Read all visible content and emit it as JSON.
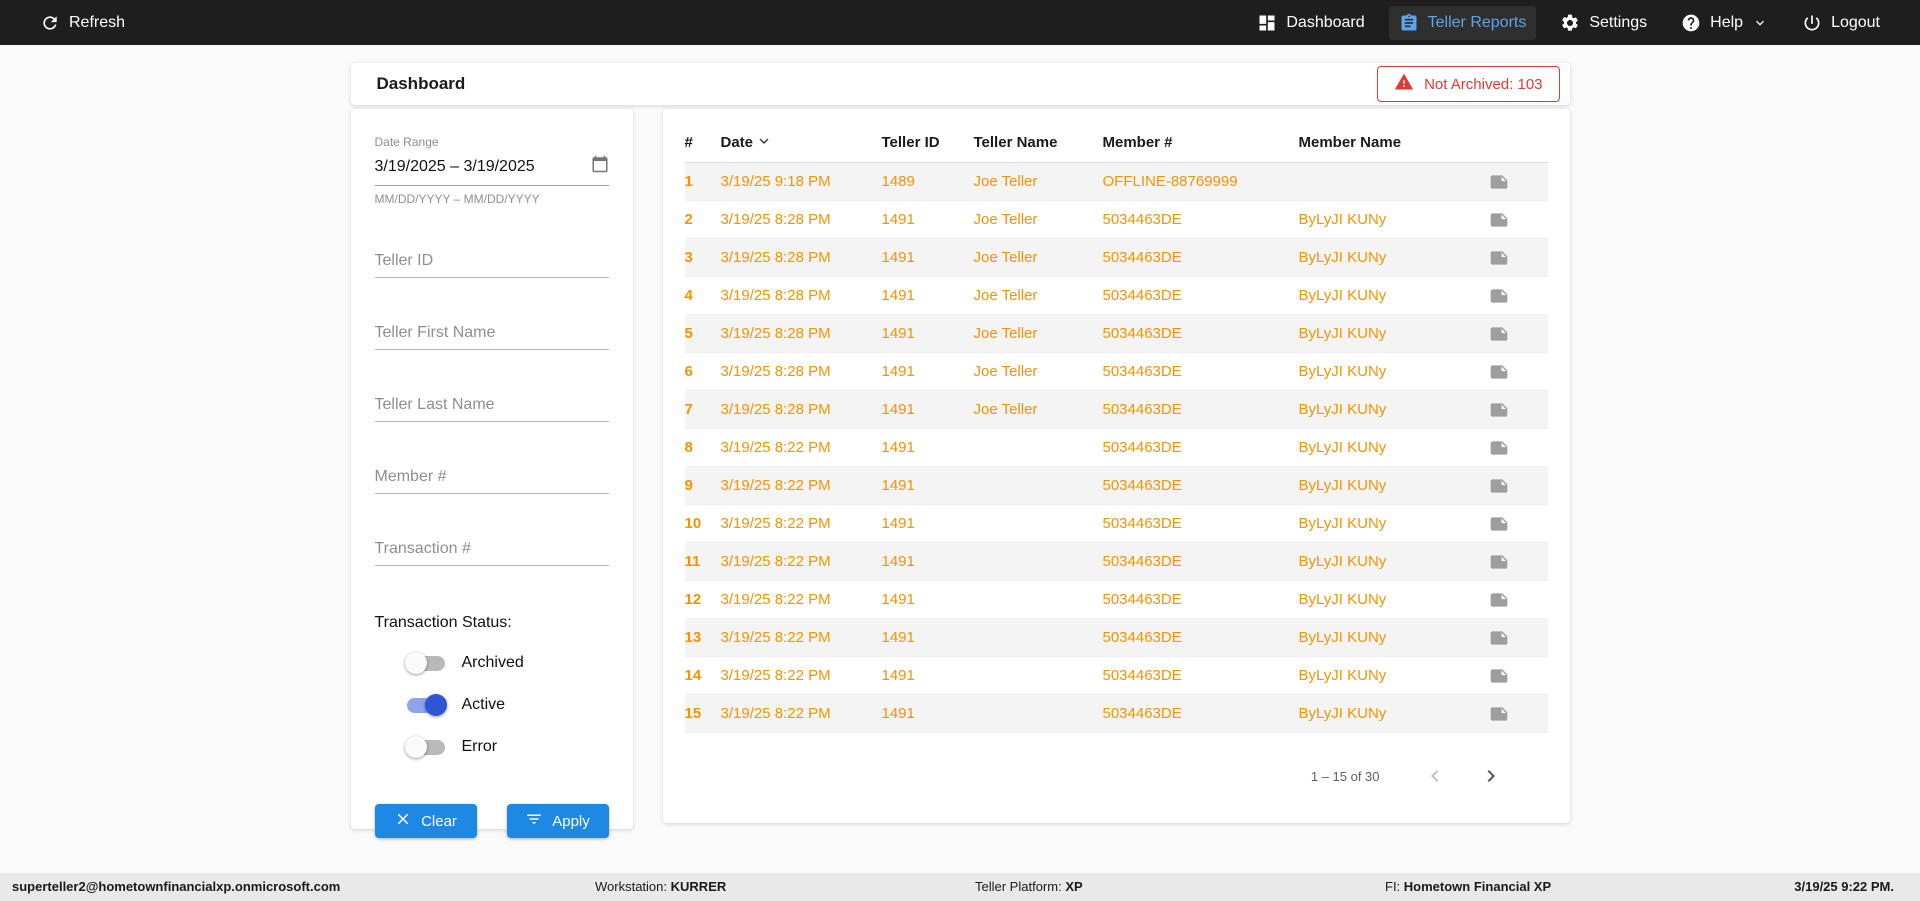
{
  "topbar": {
    "refresh_label": "Refresh",
    "nav": [
      {
        "label": "Dashboard"
      },
      {
        "label": "Teller Reports"
      },
      {
        "label": "Settings"
      },
      {
        "label": "Help"
      },
      {
        "label": "Logout"
      }
    ]
  },
  "header": {
    "title": "Dashboard",
    "not_archived": "Not Archived: 103"
  },
  "filters": {
    "date_range_label": "Date Range",
    "date_range_value": "3/19/2025 – 3/19/2025",
    "date_range_hint": "MM/DD/YYYY – MM/DD/YYYY",
    "fields": [
      {
        "placeholder": "Teller ID"
      },
      {
        "placeholder": "Teller First Name"
      },
      {
        "placeholder": "Teller Last Name"
      },
      {
        "placeholder": "Member #"
      },
      {
        "placeholder": "Transaction #"
      }
    ],
    "status_label": "Transaction Status:",
    "toggles": [
      {
        "label": "Archived",
        "on": false
      },
      {
        "label": "Active",
        "on": true
      },
      {
        "label": "Error",
        "on": false
      }
    ],
    "clear_label": "Clear",
    "apply_label": "Apply"
  },
  "table": {
    "columns": {
      "num": "#",
      "date": "Date",
      "teller_id": "Teller ID",
      "teller_name": "Teller Name",
      "member_num": "Member #",
      "member_name": "Member Name"
    },
    "rows": [
      {
        "num": "1",
        "date": "3/19/25 9:18 PM",
        "teller_id": "1489",
        "teller_name": "Joe Teller",
        "member_num": "OFFLINE-88769999",
        "member_name": ""
      },
      {
        "num": "2",
        "date": "3/19/25 8:28 PM",
        "teller_id": "1491",
        "teller_name": "Joe Teller",
        "member_num": "5034463DE",
        "member_name": "ByLyJI KUNy"
      },
      {
        "num": "3",
        "date": "3/19/25 8:28 PM",
        "teller_id": "1491",
        "teller_name": "Joe Teller",
        "member_num": "5034463DE",
        "member_name": "ByLyJI KUNy"
      },
      {
        "num": "4",
        "date": "3/19/25 8:28 PM",
        "teller_id": "1491",
        "teller_name": "Joe Teller",
        "member_num": "5034463DE",
        "member_name": "ByLyJI KUNy"
      },
      {
        "num": "5",
        "date": "3/19/25 8:28 PM",
        "teller_id": "1491",
        "teller_name": "Joe Teller",
        "member_num": "5034463DE",
        "member_name": "ByLyJI KUNy"
      },
      {
        "num": "6",
        "date": "3/19/25 8:28 PM",
        "teller_id": "1491",
        "teller_name": "Joe Teller",
        "member_num": "5034463DE",
        "member_name": "ByLyJI KUNy"
      },
      {
        "num": "7",
        "date": "3/19/25 8:28 PM",
        "teller_id": "1491",
        "teller_name": "Joe Teller",
        "member_num": "5034463DE",
        "member_name": "ByLyJI KUNy"
      },
      {
        "num": "8",
        "date": "3/19/25 8:22 PM",
        "teller_id": "1491",
        "teller_name": "",
        "member_num": "5034463DE",
        "member_name": "ByLyJI KUNy"
      },
      {
        "num": "9",
        "date": "3/19/25 8:22 PM",
        "teller_id": "1491",
        "teller_name": "",
        "member_num": "5034463DE",
        "member_name": "ByLyJI KUNy"
      },
      {
        "num": "10",
        "date": "3/19/25 8:22 PM",
        "teller_id": "1491",
        "teller_name": "",
        "member_num": "5034463DE",
        "member_name": "ByLyJI KUNy"
      },
      {
        "num": "11",
        "date": "3/19/25 8:22 PM",
        "teller_id": "1491",
        "teller_name": "",
        "member_num": "5034463DE",
        "member_name": "ByLyJI KUNy"
      },
      {
        "num": "12",
        "date": "3/19/25 8:22 PM",
        "teller_id": "1491",
        "teller_name": "",
        "member_num": "5034463DE",
        "member_name": "ByLyJI KUNy"
      },
      {
        "num": "13",
        "date": "3/19/25 8:22 PM",
        "teller_id": "1491",
        "teller_name": "",
        "member_num": "5034463DE",
        "member_name": "ByLyJI KUNy"
      },
      {
        "num": "14",
        "date": "3/19/25 8:22 PM",
        "teller_id": "1491",
        "teller_name": "",
        "member_num": "5034463DE",
        "member_name": "ByLyJI KUNy"
      },
      {
        "num": "15",
        "date": "3/19/25 8:22 PM",
        "teller_id": "1491",
        "teller_name": "",
        "member_num": "5034463DE",
        "member_name": "ByLyJI KUNy"
      }
    ],
    "pagination": {
      "range_label": "1 – 15 of 30"
    }
  },
  "footer": {
    "user": "superteller2@hometownfinancialxp.onmicrosoft.com",
    "workstation_label": "Workstation:",
    "workstation_value": "KURRER",
    "platform_label": "Teller Platform:",
    "platform_value": "XP",
    "fi_label": "FI:",
    "fi_value": "Hometown Financial XP",
    "timestamp": "3/19/25 9:22 PM."
  },
  "colors": {
    "accent_blue": "#1E88E5",
    "table_text_orange": "#F59300",
    "alert_red": "#E53935"
  }
}
